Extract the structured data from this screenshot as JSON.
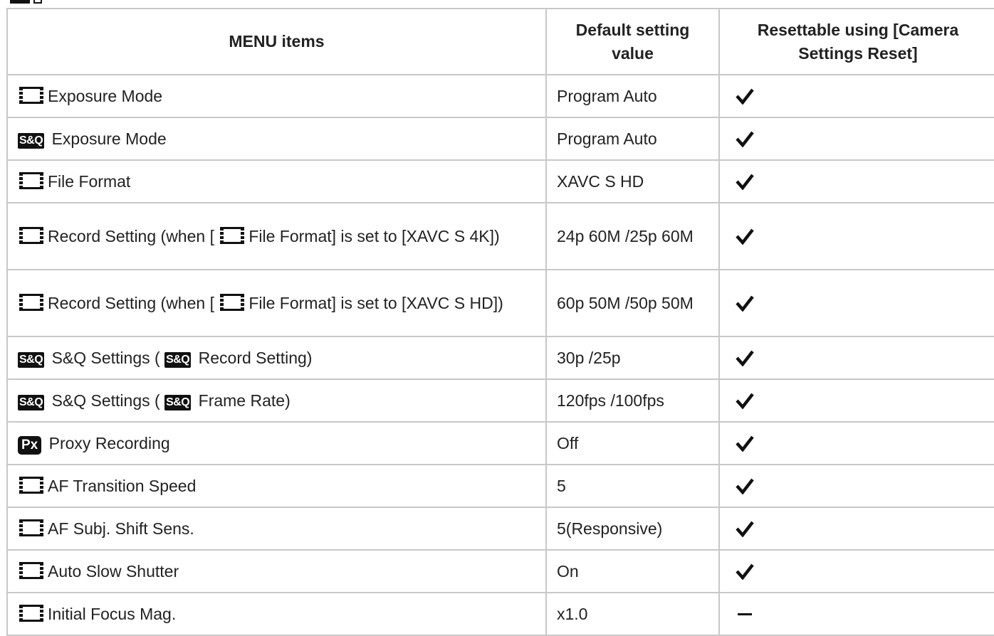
{
  "table": {
    "headers": {
      "menu_items": "MENU items",
      "default_value": "Default setting value",
      "resettable": "Resettable using [Camera Settings Reset]"
    },
    "rows": [
      {
        "pre": "",
        "label1": "Exposure Mode",
        "mid": "",
        "label2": "",
        "default": "Program Auto"
      },
      {
        "pre": "S&Q",
        "label1": "Exposure Mode",
        "mid": "",
        "label2": "",
        "default": "Program Auto"
      },
      {
        "pre": "",
        "label1": "File Format",
        "mid": "",
        "label2": "",
        "default": "XAVC S HD"
      },
      {
        "pre": "",
        "label1": "Record Setting (when [",
        "mid": "",
        "label2": "File Format] is set to [XAVC S 4K])",
        "default": "24p 60M /25p 60M"
      },
      {
        "pre": "",
        "label1": "Record Setting (when [",
        "mid": "",
        "label2": "File Format] is set to [XAVC S HD])",
        "default": "60p 50M /50p 50M"
      },
      {
        "pre": "S&Q",
        "label1": "S&Q Settings (",
        "mid": "S&Q",
        "label2": "Record Setting)",
        "default": "30p /25p"
      },
      {
        "pre": "S&Q",
        "label1": "S&Q Settings (",
        "mid": "S&Q",
        "label2": "Frame Rate)",
        "default": "120fps /100fps"
      },
      {
        "pre": "Px",
        "label1": "Proxy Recording",
        "mid": "",
        "label2": "",
        "default": "Off"
      },
      {
        "pre": "",
        "label1": "AF Transition Speed",
        "mid": "",
        "label2": "",
        "default": "5"
      },
      {
        "pre": "",
        "label1": "AF Subj. Shift Sens.",
        "mid": "",
        "label2": "",
        "default": "5(Responsive)"
      },
      {
        "pre": "",
        "label1": "Auto Slow Shutter",
        "mid": "",
        "label2": "",
        "default": "On"
      },
      {
        "pre": "",
        "label1": "Initial Focus Mag.",
        "mid": "",
        "label2": "",
        "default": "x1.0"
      }
    ],
    "icons": {
      "pre": [
        "movie-icon",
        "snq-icon",
        "movie-icon",
        "movie-icon",
        "movie-icon",
        "snq-icon",
        "snq-icon",
        "proxy-icon",
        "movie-icon",
        "movie-icon",
        "movie-icon",
        "movie-icon"
      ],
      "mid": [
        "",
        "",
        "",
        "movie-icon",
        "movie-icon",
        "snq-icon",
        "snq-icon",
        "",
        "",
        "",
        "",
        ""
      ],
      "resettable": [
        "check-icon",
        "check-icon",
        "check-icon",
        "check-icon",
        "check-icon",
        "check-icon",
        "check-icon",
        "check-icon",
        "check-icon",
        "check-icon",
        "check-icon",
        "dash-icon"
      ]
    }
  },
  "colors": {
    "border": "#c8c8c8",
    "text": "#222222"
  }
}
